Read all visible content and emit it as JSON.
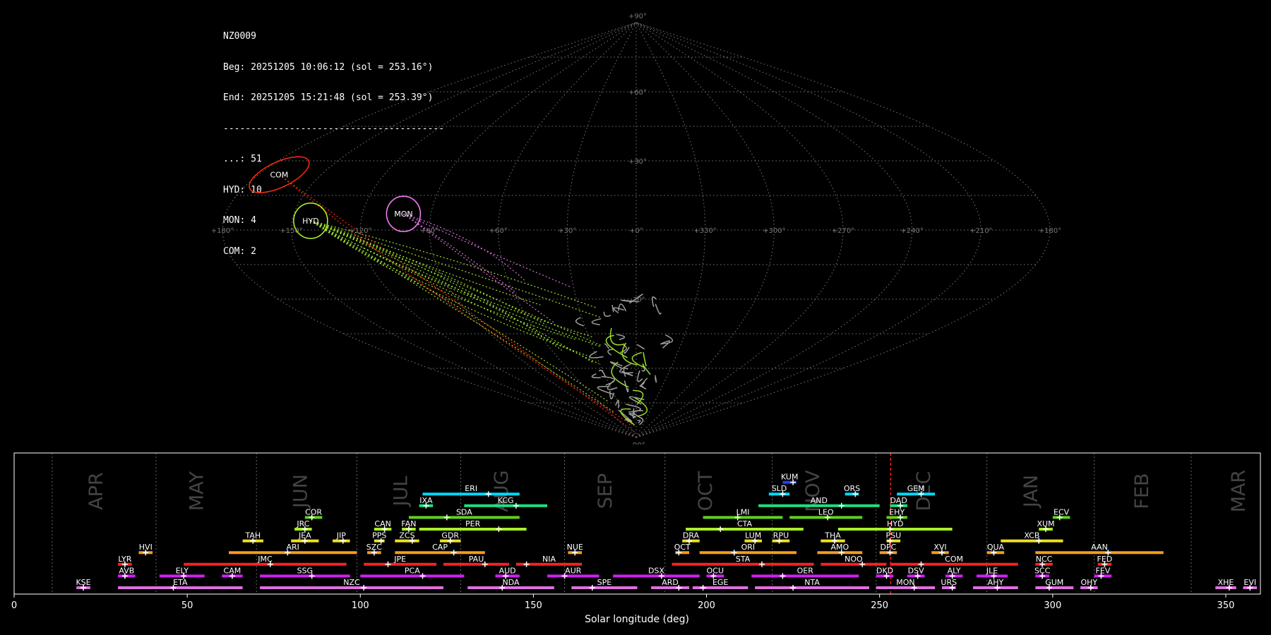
{
  "header": {
    "station": "NZ0009",
    "begin": "Beg: 20251205 10:06:12 (sol = 253.16°)",
    "end": "End: 20251205 15:21:48 (sol = 253.39°)",
    "separator": "----------------------------------------",
    "counts": [
      "...: 51",
      "HYD: 10",
      "MON: 4",
      "COM: 2"
    ]
  },
  "sky_map": {
    "projection": "sinusoidal (RA/Dec)",
    "ra_tick_labels": [
      "+180°",
      "+150°",
      "+120°",
      "+90°",
      "+60°",
      "+30°",
      "+0°",
      "+330°",
      "+300°",
      "+270°",
      "+240°",
      "+210°",
      "+180°"
    ],
    "dec_tick_labels": [
      "+90°",
      "+60°",
      "+30°",
      "-30°",
      "-90°"
    ],
    "radiants": [
      {
        "code": "COM",
        "ra": 170,
        "dec": 24,
        "color": "#ff2a10"
      },
      {
        "code": "HYD",
        "ra": 142,
        "dec": 4,
        "color": "#b4ff2a"
      },
      {
        "code": "MON",
        "ra": 102,
        "dec": 7,
        "color": "#ff80ff"
      }
    ],
    "colors": {
      "sporadic": "#a0a0a0",
      "HYD": "#9be02a",
      "MON": "#e070e0",
      "COM": "#ff2a10"
    }
  },
  "chart_data": {
    "type": "timeline",
    "xlabel": "Solar longitude (deg)",
    "xlim": [
      0,
      360
    ],
    "x_ticks": [
      0,
      50,
      100,
      150,
      200,
      250,
      300,
      350
    ],
    "current_sol": 253.2,
    "months": [
      {
        "name": "APR",
        "x": 24
      },
      {
        "name": "MAY",
        "x": 53
      },
      {
        "name": "JUN",
        "x": 83
      },
      {
        "name": "JUL",
        "x": 112
      },
      {
        "name": "AUG",
        "x": 141
      },
      {
        "name": "SEP",
        "x": 171
      },
      {
        "name": "OCT",
        "x": 200
      },
      {
        "name": "NOV",
        "x": 231
      },
      {
        "name": "DEC",
        "x": 263
      },
      {
        "name": "JAN",
        "x": 294
      },
      {
        "name": "FEB",
        "x": 326
      },
      {
        "name": "MAR",
        "x": 354
      }
    ],
    "month_boundaries": [
      11,
      41,
      70,
      99,
      129,
      159,
      188,
      219,
      249,
      281,
      312,
      340
    ],
    "showers": [
      {
        "code": "KUM",
        "start": 222,
        "end": 226,
        "peak": 225,
        "row": 9,
        "color": "#2040ff"
      },
      {
        "code": "ERI",
        "start": 118,
        "end": 146,
        "peak": 137,
        "row": 8,
        "color": "#00d8ff"
      },
      {
        "code": "SLD",
        "start": 218,
        "end": 224,
        "peak": 222,
        "row": 8,
        "color": "#00d8ff"
      },
      {
        "code": "ORS",
        "start": 240,
        "end": 244,
        "peak": 243,
        "row": 8,
        "color": "#00d8ff"
      },
      {
        "code": "GEM",
        "start": 255,
        "end": 266,
        "peak": 262,
        "row": 8,
        "color": "#00d8ff"
      },
      {
        "code": "IXA",
        "start": 117,
        "end": 121,
        "peak": 119,
        "row": 7,
        "color": "#20e080"
      },
      {
        "code": "KCG",
        "start": 130,
        "end": 154,
        "peak": 145,
        "row": 7,
        "color": "#20e080"
      },
      {
        "code": "AND",
        "start": 215,
        "end": 250,
        "peak": 239,
        "row": 7,
        "color": "#20e080"
      },
      {
        "code": "DAD",
        "start": 253,
        "end": 258,
        "peak": 256,
        "row": 7,
        "color": "#20e080"
      },
      {
        "code": "COR",
        "start": 84,
        "end": 89,
        "peak": 86,
        "row": 6,
        "color": "#60d020"
      },
      {
        "code": "SDA",
        "start": 114,
        "end": 146,
        "peak": 125,
        "row": 6,
        "color": "#60d020"
      },
      {
        "code": "LMI",
        "start": 199,
        "end": 222,
        "peak": 209,
        "row": 6,
        "color": "#60d020"
      },
      {
        "code": "LEO",
        "start": 224,
        "end": 245,
        "peak": 235,
        "row": 6,
        "color": "#60d020"
      },
      {
        "code": "EHY",
        "start": 252,
        "end": 258,
        "peak": 256,
        "row": 6,
        "color": "#60d020"
      },
      {
        "code": "ECV",
        "start": 300,
        "end": 305,
        "peak": 302,
        "row": 6,
        "color": "#60d020"
      },
      {
        "code": "JRC",
        "start": 81,
        "end": 86,
        "peak": 84,
        "row": 5,
        "color": "#a8ef28"
      },
      {
        "code": "CAN",
        "start": 104,
        "end": 109,
        "peak": 107,
        "row": 5,
        "color": "#a8ef28"
      },
      {
        "code": "FAN",
        "start": 112,
        "end": 116,
        "peak": 114,
        "row": 5,
        "color": "#a8ef28"
      },
      {
        "code": "PER",
        "start": 117,
        "end": 148,
        "peak": 140,
        "row": 5,
        "color": "#a8ef28"
      },
      {
        "code": "CTA",
        "start": 194,
        "end": 228,
        "peak": 204,
        "row": 5,
        "color": "#a8ef28"
      },
      {
        "code": "HYD",
        "start": 238,
        "end": 271,
        "peak": 253,
        "row": 5,
        "color": "#a8ef28"
      },
      {
        "code": "XUM",
        "start": 296,
        "end": 300,
        "peak": 298,
        "row": 5,
        "color": "#a8ef28"
      },
      {
        "code": "TAH",
        "start": 66,
        "end": 72,
        "peak": 69,
        "row": 4,
        "color": "#f0e020"
      },
      {
        "code": "JEA",
        "start": 80,
        "end": 88,
        "peak": 84,
        "row": 4,
        "color": "#f0e020"
      },
      {
        "code": "JIP",
        "start": 92,
        "end": 97,
        "peak": 95,
        "row": 4,
        "color": "#f0e020"
      },
      {
        "code": "PPS",
        "start": 104,
        "end": 107,
        "peak": 106,
        "row": 4,
        "color": "#f0e020"
      },
      {
        "code": "ZCS",
        "start": 110,
        "end": 117,
        "peak": 115,
        "row": 4,
        "color": "#f0e020"
      },
      {
        "code": "GDR",
        "start": 123,
        "end": 129,
        "peak": 126,
        "row": 4,
        "color": "#f0e020"
      },
      {
        "code": "DRA",
        "start": 193,
        "end": 198,
        "peak": 195,
        "row": 4,
        "color": "#f0e020"
      },
      {
        "code": "LUM",
        "start": 211,
        "end": 216,
        "peak": 214,
        "row": 4,
        "color": "#f0e020"
      },
      {
        "code": "RPU",
        "start": 219,
        "end": 224,
        "peak": 221,
        "row": 4,
        "color": "#f0e020"
      },
      {
        "code": "THA",
        "start": 233,
        "end": 240,
        "peak": 237,
        "row": 4,
        "color": "#f0e020"
      },
      {
        "code": "PSU",
        "start": 252,
        "end": 256,
        "peak": 253,
        "row": 4,
        "color": "#f0e020"
      },
      {
        "code": "XCB",
        "start": 285,
        "end": 303,
        "peak": 296,
        "row": 4,
        "color": "#f0e020"
      },
      {
        "code": "HVI",
        "start": 36,
        "end": 40,
        "peak": 38,
        "row": 3,
        "color": "#ff9a1a"
      },
      {
        "code": "ARI",
        "start": 62,
        "end": 99,
        "peak": 79,
        "row": 3,
        "color": "#ff9a1a"
      },
      {
        "code": "SZC",
        "start": 102,
        "end": 106,
        "peak": 104,
        "row": 3,
        "color": "#ff9a1a"
      },
      {
        "code": "CAP",
        "start": 110,
        "end": 136,
        "peak": 127,
        "row": 3,
        "color": "#ff9a1a"
      },
      {
        "code": "NUE",
        "start": 160,
        "end": 164,
        "peak": 162,
        "row": 3,
        "color": "#ff9a1a"
      },
      {
        "code": "OCT",
        "start": 191,
        "end": 195,
        "peak": 192,
        "row": 3,
        "color": "#ff9a1a"
      },
      {
        "code": "ORI",
        "start": 198,
        "end": 226,
        "peak": 208,
        "row": 3,
        "color": "#ff9a1a"
      },
      {
        "code": "AMO",
        "start": 232,
        "end": 245,
        "peak": 239,
        "row": 3,
        "color": "#ff9a1a"
      },
      {
        "code": "DPC",
        "start": 250,
        "end": 255,
        "peak": 253,
        "row": 3,
        "color": "#ff9a1a"
      },
      {
        "code": "XVI",
        "start": 265,
        "end": 270,
        "peak": 268,
        "row": 3,
        "color": "#ff9a1a"
      },
      {
        "code": "QUA",
        "start": 281,
        "end": 286,
        "peak": 283,
        "row": 3,
        "color": "#ff9a1a"
      },
      {
        "code": "AAN",
        "start": 295,
        "end": 332,
        "peak": 316,
        "row": 3,
        "color": "#ff9a1a"
      },
      {
        "code": "LYR",
        "start": 30,
        "end": 34,
        "peak": 32,
        "row": 2,
        "color": "#ff2020"
      },
      {
        "code": "JMC",
        "start": 49,
        "end": 96,
        "peak": 74,
        "row": 2,
        "color": "#ff2020"
      },
      {
        "code": "JPE",
        "start": 101,
        "end": 122,
        "peak": 108,
        "row": 2,
        "color": "#ff2020"
      },
      {
        "code": "PAU",
        "start": 124,
        "end": 143,
        "peak": 136,
        "row": 2,
        "color": "#ff2020"
      },
      {
        "code": "NIA",
        "start": 145,
        "end": 164,
        "peak": 148,
        "row": 2,
        "color": "#ff2020"
      },
      {
        "code": "STA",
        "start": 190,
        "end": 231,
        "peak": 216,
        "row": 2,
        "color": "#ff2020"
      },
      {
        "code": "NOO",
        "start": 233,
        "end": 252,
        "peak": 245,
        "row": 2,
        "color": "#ff2020"
      },
      {
        "code": "COM",
        "start": 253,
        "end": 290,
        "peak": 262,
        "row": 2,
        "color": "#ff2020"
      },
      {
        "code": "NCC",
        "start": 295,
        "end": 300,
        "peak": 297,
        "row": 2,
        "color": "#ff2020"
      },
      {
        "code": "FED",
        "start": 313,
        "end": 317,
        "peak": 315,
        "row": 2,
        "color": "#ff2020"
      },
      {
        "code": "AVB",
        "start": 30,
        "end": 35,
        "peak": 32,
        "row": 1,
        "color": "#d020f0"
      },
      {
        "code": "ELY",
        "start": 42,
        "end": 55,
        "peak": 49,
        "row": 1,
        "color": "#d020f0"
      },
      {
        "code": "CAM",
        "start": 60,
        "end": 66,
        "peak": 63,
        "row": 1,
        "color": "#d020f0"
      },
      {
        "code": "SSG",
        "start": 71,
        "end": 97,
        "peak": 86,
        "row": 1,
        "color": "#d020f0"
      },
      {
        "code": "PCA",
        "start": 100,
        "end": 130,
        "peak": 118,
        "row": 1,
        "color": "#d020f0"
      },
      {
        "code": "AUD",
        "start": 139,
        "end": 146,
        "peak": 142,
        "row": 1,
        "color": "#d020f0"
      },
      {
        "code": "AUR",
        "start": 154,
        "end": 169,
        "peak": 159,
        "row": 1,
        "color": "#d020f0"
      },
      {
        "code": "DSX",
        "start": 173,
        "end": 198,
        "peak": 187,
        "row": 1,
        "color": "#d020f0"
      },
      {
        "code": "OCU",
        "start": 200,
        "end": 205,
        "peak": 202,
        "row": 1,
        "color": "#d020f0"
      },
      {
        "code": "OER",
        "start": 213,
        "end": 244,
        "peak": 222,
        "row": 1,
        "color": "#d020f0"
      },
      {
        "code": "DKD",
        "start": 249,
        "end": 254,
        "peak": 252,
        "row": 1,
        "color": "#d020f0"
      },
      {
        "code": "DSV",
        "start": 258,
        "end": 263,
        "peak": 261,
        "row": 1,
        "color": "#d020f0"
      },
      {
        "code": "ALY",
        "start": 269,
        "end": 274,
        "peak": 271,
        "row": 1,
        "color": "#d020f0"
      },
      {
        "code": "JLE",
        "start": 278,
        "end": 287,
        "peak": 283,
        "row": 1,
        "color": "#d020f0"
      },
      {
        "code": "SCC",
        "start": 295,
        "end": 299,
        "peak": 297,
        "row": 1,
        "color": "#d020f0"
      },
      {
        "code": "FEV",
        "start": 312,
        "end": 317,
        "peak": 314,
        "row": 1,
        "color": "#d020f0"
      },
      {
        "code": "KSE",
        "start": 18,
        "end": 22,
        "peak": 20,
        "row": 0,
        "color": "#e070e0"
      },
      {
        "code": "ETA",
        "start": 30,
        "end": 66,
        "peak": 46,
        "row": 0,
        "color": "#e070e0"
      },
      {
        "code": "NZC",
        "start": 71,
        "end": 124,
        "peak": 101,
        "row": 0,
        "color": "#e070e0"
      },
      {
        "code": "NDA",
        "start": 131,
        "end": 156,
        "peak": 141,
        "row": 0,
        "color": "#e070e0"
      },
      {
        "code": "SPE",
        "start": 161,
        "end": 180,
        "peak": 167,
        "row": 0,
        "color": "#e070e0"
      },
      {
        "code": "ARD",
        "start": 184,
        "end": 195,
        "peak": 192,
        "row": 0,
        "color": "#e070e0"
      },
      {
        "code": "EGE",
        "start": 196,
        "end": 212,
        "peak": 199,
        "row": 0,
        "color": "#e070e0"
      },
      {
        "code": "NTA",
        "start": 214,
        "end": 247,
        "peak": 225,
        "row": 0,
        "color": "#e070e0"
      },
      {
        "code": "MON",
        "start": 249,
        "end": 266,
        "peak": 260,
        "row": 0,
        "color": "#e070e0"
      },
      {
        "code": "URS",
        "start": 268,
        "end": 272,
        "peak": 271,
        "row": 0,
        "color": "#e070e0"
      },
      {
        "code": "AHY",
        "start": 277,
        "end": 290,
        "peak": 284,
        "row": 0,
        "color": "#e070e0"
      },
      {
        "code": "GUM",
        "start": 295,
        "end": 306,
        "peak": 299,
        "row": 0,
        "color": "#e070e0"
      },
      {
        "code": "OHY",
        "start": 308,
        "end": 313,
        "peak": 311,
        "row": 0,
        "color": "#e070e0"
      },
      {
        "code": "XHE",
        "start": 347,
        "end": 353,
        "peak": 351,
        "row": 0,
        "color": "#e070e0"
      },
      {
        "code": "EVI",
        "start": 355,
        "end": 359,
        "peak": 357,
        "row": 0,
        "color": "#e070e0"
      }
    ]
  }
}
